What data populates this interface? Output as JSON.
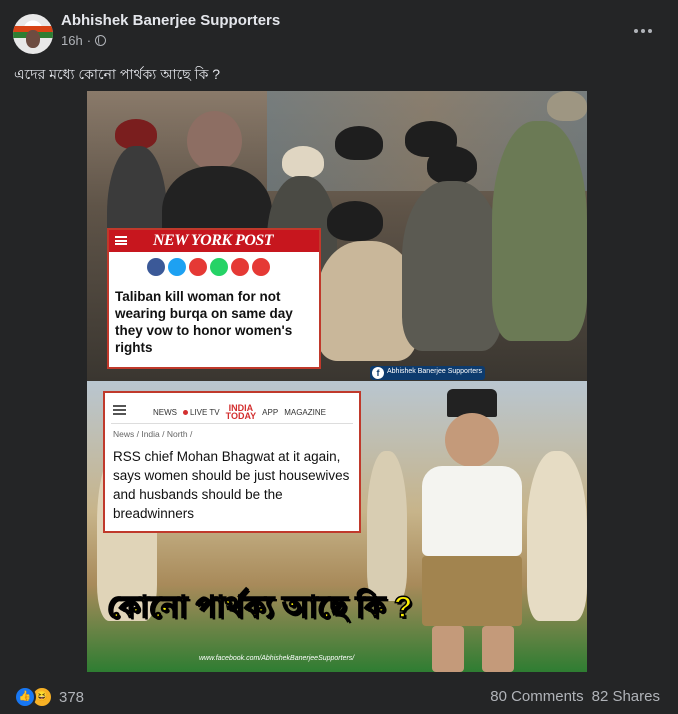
{
  "post": {
    "page_name": "Abhishek Banerjee Supporters",
    "time": "16h",
    "separator": "·",
    "caption": "এদের মধ্যে কোনো পার্থক্য আছে কি ?"
  },
  "image": {
    "nyp": {
      "logo": "NEW YORK POST",
      "headline": "Taliban kill woman for not wearing burqa on same day they vow to honor women's rights"
    },
    "watermark": "Abhishek Banerjee Supporters",
    "india_today": {
      "nav": [
        "NEWS",
        "LIVE TV",
        "APP",
        "MAGAZINE"
      ],
      "logo_top": "INDIA",
      "logo_bottom": "TODAY",
      "breadcrumb": "News / India / North /",
      "headline": "RSS chief Mohan Bhagwat at it again, says women should be just housewives and husbands should be the breadwinners"
    },
    "overlay_text": "কোনো পার্থক্য আছে কি ?",
    "url": "www.facebook.com/AbhishekBanerjeeSupporters/"
  },
  "footer": {
    "reaction_count": "378",
    "comments": "80 Comments",
    "shares": "82 Shares"
  },
  "icons": {
    "like": "like-icon",
    "haha": "haha-icon",
    "globe": "globe-icon",
    "more": "more-options-icon"
  },
  "colors": {
    "background": "#242526",
    "nyp_red": "#c7161e",
    "overlay_yellow": "#fff200",
    "like_blue": "#1877f2"
  }
}
